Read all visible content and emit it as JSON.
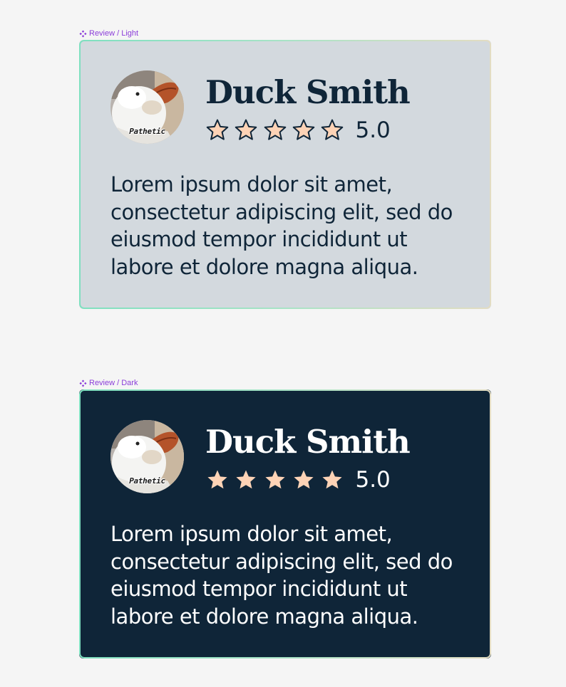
{
  "frames": {
    "light": {
      "label": "Review / Light",
      "label_icon": "component-icon",
      "name": "Duck Smith",
      "avatar_caption": "Pathetic",
      "stars": 5,
      "rating": "5.0",
      "body": "Lorem ipsum dolor sit amet, consectetur adipiscing elit, sed do eiusmod tempor incididunt ut labore et dolore magna aliqua."
    },
    "dark": {
      "label": "Review / Dark",
      "label_icon": "component-icon",
      "name": "Duck Smith",
      "avatar_caption": "Pathetic",
      "stars": 5,
      "rating": "5.0",
      "body": "Lorem ipsum dolor sit amet, consectetur adipiscing elit, sed do eiusmod tempor incididunt ut labore et dolore magna aliqua."
    }
  },
  "colors": {
    "page_bg": "#f5f5f5",
    "label_purple": "#8b3dd9",
    "light_card_bg": "#d3d9de",
    "dark_card_bg": "#0f2538",
    "navy_text": "#0f2538",
    "star_fill": "#fdd3b6",
    "star_outline": "#0f2538",
    "border_gradient": [
      "#7fe0c0",
      "#e3dcc2"
    ]
  },
  "icons": {
    "star": "star-icon",
    "label": "component-icon",
    "avatar": "duck-avatar-image"
  }
}
